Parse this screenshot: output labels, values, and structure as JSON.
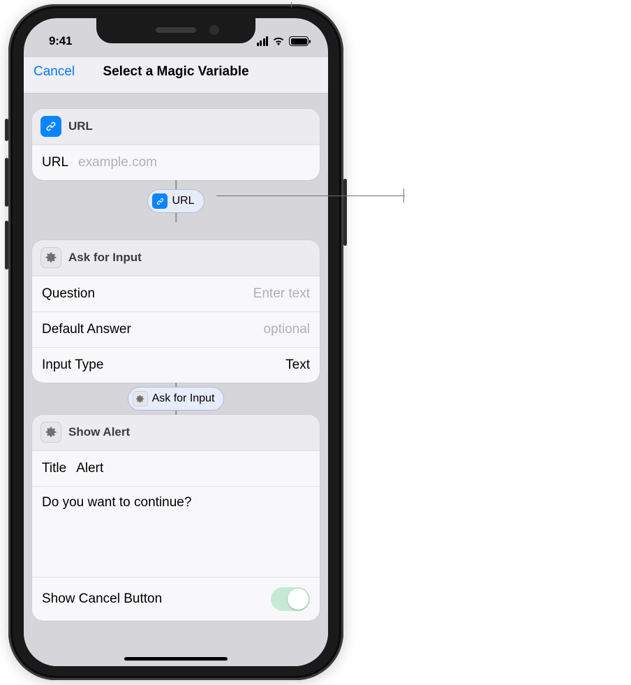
{
  "status": {
    "time": "9:41"
  },
  "nav": {
    "cancel": "Cancel",
    "title": "Select a Magic Variable"
  },
  "actions": {
    "url": {
      "title": "URL",
      "row_label": "URL",
      "placeholder": "example.com",
      "pill": "URL"
    },
    "ask": {
      "title": "Ask for Input",
      "question_label": "Question",
      "question_placeholder": "Enter text",
      "default_label": "Default Answer",
      "default_placeholder": "optional",
      "input_type_label": "Input Type",
      "input_type_value": "Text",
      "pill": "Ask for Input"
    },
    "alert": {
      "title": "Show Alert",
      "title_label": "Title",
      "title_value": "Alert",
      "body": "Do you want to continue?",
      "show_cancel_label": "Show Cancel Button"
    }
  }
}
